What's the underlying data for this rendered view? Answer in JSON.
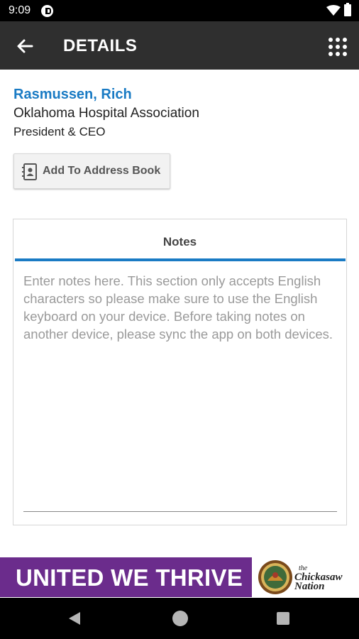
{
  "status_bar": {
    "time": "9:09"
  },
  "app_bar": {
    "title": "DETAILS"
  },
  "contact": {
    "name": "Rasmussen, Rich",
    "organization": "Oklahoma Hospital Association",
    "title": "President & CEO"
  },
  "actions": {
    "add_to_address_book": "Add To Address Book"
  },
  "notes": {
    "tab_label": "Notes",
    "value": "",
    "placeholder": "Enter notes here. This section only accepts English characters so please make sure to use the English keyboard on your device. Before taking notes on another device, please sync the app on both devices."
  },
  "ad": {
    "headline": "UNITED WE THRIVE",
    "brand_line1": "the",
    "brand_line2": "Chickasaw",
    "brand_line3": "Nation"
  },
  "colors": {
    "accent": "#1a7bc4",
    "app_bar": "#2f2f2f",
    "ad_purple": "#6b2c8c"
  },
  "icons": {
    "back": "arrow-left-icon",
    "menu": "grid-dots-icon",
    "contact_book": "contact-card-icon",
    "wifi": "wifi-icon",
    "battery": "battery-icon"
  }
}
